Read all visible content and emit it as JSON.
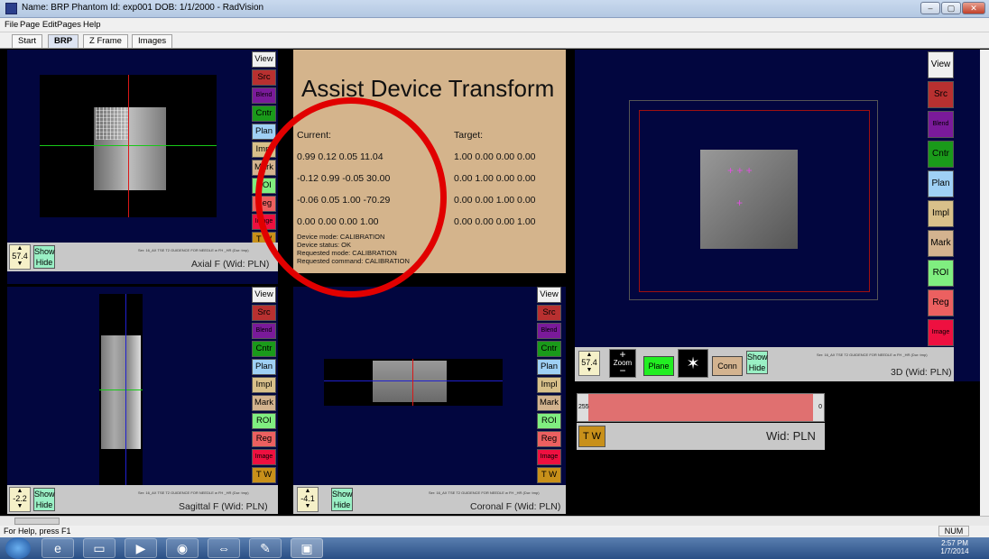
{
  "window": {
    "title": "Name: BRP  Phantom   Id: exp001   DOB: 1/1/2000 - RadVision",
    "buttons": [
      "–",
      "▢",
      "✕"
    ]
  },
  "menu": [
    "File",
    "Page Edit",
    "Pages",
    "Help"
  ],
  "tabs": [
    "Start",
    "BRP",
    "Z Frame",
    "Images"
  ],
  "side_buttons": [
    "View",
    "Src",
    "Blend",
    "Cntr",
    "Plan",
    "Impl",
    "Mark",
    "ROI",
    "Reg",
    "Image",
    "T W"
  ],
  "colors": {
    "View": "#f0f0f0",
    "Src": "#b83030",
    "Blend": "#7a1a9a",
    "Cntr": "#1a9a1a",
    "Plan": "#9fd0f5",
    "Impl": "#d8c08a",
    "Mark": "#d3b38f",
    "ROI": "#80ee80",
    "Reg": "#ec6060",
    "Image": "#ee1040",
    "T W": "#c8901a"
  },
  "axial": {
    "zoom": "57.4",
    "show": "Show",
    "hide": "Hide",
    "label": "Axial F (Wid: PLN)",
    "series": "Ser: 16_AX TSE T2 GUIDENCE FOR NEEDLE w FH _HR (Dur: tmp)"
  },
  "sagittal": {
    "zoom": "-2.2",
    "show": "Show",
    "hide": "Hide",
    "label": "Sagittal F (Wid: PLN)",
    "series": "Ser: 16_AX TSE T2 GUIDENCE FOR NEEDLE w FH _HR (Dur: tmp)"
  },
  "coronal": {
    "zoom": "-4.1",
    "show": "Show",
    "hide": "Hide",
    "label": "Coronal F (Wid: PLN)",
    "series": "Ser: 16_AX TSE T2 GUIDENCE FOR NEEDLE w FH _HR (Dur: tmp)"
  },
  "view3d": {
    "zoom": "57.4",
    "zoom_btn": "Zoom",
    "plane": "Plane",
    "conn": "Conn",
    "show": "Show",
    "hide": "Hide",
    "label": "3D (Wid: PLN)",
    "series": "Ser: 16_AX TSE T2 GUIDENCE FOR NEEDLE w FH _HR (Dur: tmp)",
    "tw": "T W",
    "wid_label": "Wid: PLN",
    "range_min": "255",
    "range_max": "0"
  },
  "assist": {
    "title": "Assist Device Transform",
    "current_label": "Current:",
    "target_label": "Target:",
    "current": [
      "0.99 0.12 0.05 11.04",
      "-0.12 0.99 -0.05 30.00",
      "-0.06 0.05 1.00 -70.29",
      "0.00 0.00 0.00 1.00"
    ],
    "target": [
      "1.00 0.00 0.00 0.00",
      "0.00 1.00 0.00 0.00",
      "0.00 0.00 1.00 0.00",
      "0.00 0.00 0.00 1.00"
    ],
    "status": [
      "Device mode: CALIBRATION",
      "Device status: OK",
      "Requested mode: CALIBRATION",
      "Requested command: CALIBRATION"
    ]
  },
  "statusbar": {
    "help": "For Help, press F1",
    "num": "NUM"
  },
  "taskbar": {
    "time": "2:57 PM",
    "date": "1/7/2014"
  }
}
